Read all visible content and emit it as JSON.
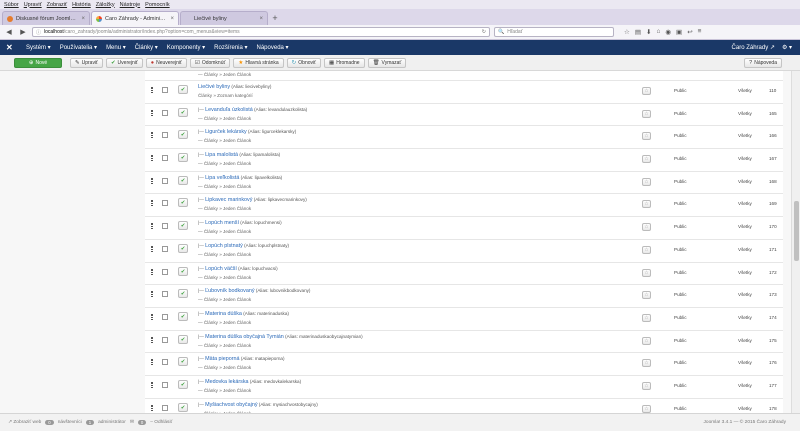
{
  "browser": {
    "menu": [
      "Súbor",
      "Upraviť",
      "Zobraziť",
      "História",
      "Záložky",
      "Nástroje",
      "Pomocník"
    ],
    "tabs": [
      {
        "title": "Diskusné fórum Joomla - Tvorba...",
        "active": false
      },
      {
        "title": "Čaro Záhrady - Administrácia",
        "active": true
      },
      {
        "title": "Liečivé byliny",
        "active": false
      }
    ],
    "new_tab": "+",
    "url_host": "localhost",
    "url_path": "/caro_zahrady/joomla/administrator/index.php?option=com_menus&view=items",
    "search_placeholder": "Hľadať"
  },
  "joomla_nav": {
    "items": [
      "Systém ▾",
      "Používatelia ▾",
      "Menu ▾",
      "Články ▾",
      "Komponenty ▾",
      "Rozšírenia ▾",
      "Nápoveda ▾"
    ],
    "site_name": "Čaro Záhrady ↗",
    "user_icon": "user-icon ▾"
  },
  "toolbar": {
    "new": "Nové",
    "edit": "Upraviť",
    "publish": "Uverejniť",
    "unpublish": "Neuverejniť",
    "checkin": "Odomknúť",
    "home": "Hlavná stránka",
    "rebuild": "Obnoviť",
    "batch": "Hromadne",
    "trash": "Vymazať",
    "help": "Nápoveda"
  },
  "rows": [
    {
      "partial": true,
      "sub": "— Články » Jeden Článok"
    },
    {
      "tree": "",
      "name": "Liečivé byliny",
      "alias": "(Alias: liecivebyliny)",
      "sub": "Články » Zoznam kategórií",
      "access": "Public",
      "lang": "Všetky",
      "id": "110"
    },
    {
      "tree": "|— ",
      "name": "Levanduľa úzkolistá",
      "alias": "(Alias: levandulauzkolista)",
      "sub": "— Články » Jeden Článok",
      "access": "Public",
      "lang": "Všetky",
      "id": "165"
    },
    {
      "tree": "|— ",
      "name": "Ligurček lekársky",
      "alias": "(Alias: ligurceklekarsky)",
      "sub": "— Články » Jeden Článok",
      "access": "Public",
      "lang": "Všetky",
      "id": "166"
    },
    {
      "tree": "|— ",
      "name": "Lipa malolistá",
      "alias": "(Alias: lipamalolista)",
      "sub": "— Články » Jeden Článok",
      "access": "Public",
      "lang": "Všetky",
      "id": "167"
    },
    {
      "tree": "|— ",
      "name": "Lipa veľkolistá",
      "alias": "(Alias: lipavelkolista)",
      "sub": "— Články » Jeden Článok",
      "access": "Public",
      "lang": "Všetky",
      "id": "168"
    },
    {
      "tree": "|— ",
      "name": "Lipkavec marinkový",
      "alias": "(Alias: lipkavecmarinkovy)",
      "sub": "— Články » Jeden Článok",
      "access": "Public",
      "lang": "Všetky",
      "id": "169"
    },
    {
      "tree": "|— ",
      "name": "Lopúch menší",
      "alias": "(Alias: lopuchmensi)",
      "sub": "— Články » Jeden Článok",
      "access": "Public",
      "lang": "Všetky",
      "id": "170"
    },
    {
      "tree": "|— ",
      "name": "Lopúch plstnatý",
      "alias": "(Alias: lopuchplstnaty)",
      "sub": "— Články » Jeden Článok",
      "access": "Public",
      "lang": "Všetky",
      "id": "171"
    },
    {
      "tree": "|— ",
      "name": "Lopúch väčší",
      "alias": "(Alias: lopuchvacsi)",
      "sub": "— Články » Jeden Článok",
      "access": "Public",
      "lang": "Všetky",
      "id": "172"
    },
    {
      "tree": "|— ",
      "name": "Ľubovník bodkovaný",
      "alias": "(Alias: lubovnikbodkovany)",
      "sub": "— Články » Jeden Článok",
      "access": "Public",
      "lang": "Všetky",
      "id": "173"
    },
    {
      "tree": "|— ",
      "name": "Materina dúška",
      "alias": "(Alias: materinaduska)",
      "sub": "— Články » Jeden Článok",
      "access": "Public",
      "lang": "Všetky",
      "id": "174"
    },
    {
      "tree": "|— ",
      "name": "Materina dúška obyčajná Tymián",
      "alias": "(Alias: materinaduskaobycajnatymian)",
      "sub": "— Články » Jeden Článok",
      "access": "Public",
      "lang": "Všetky",
      "id": "175"
    },
    {
      "tree": "|— ",
      "name": "Mäta pieporná",
      "alias": "(Alias: matapieporna)",
      "sub": "— Články » Jeden Článok",
      "access": "Public",
      "lang": "Všetky",
      "id": "176"
    },
    {
      "tree": "|— ",
      "name": "Medovka lekárska",
      "alias": "(Alias: medovkalekarska)",
      "sub": "— Články » Jeden Článok",
      "access": "Public",
      "lang": "Všetky",
      "id": "177"
    },
    {
      "tree": "|— ",
      "name": "Myšiachvost obyčajný",
      "alias": "(Alias: mysiachvostobycajny)",
      "sub": "— Články » Jeden Článok",
      "access": "Public",
      "lang": "Všetky",
      "id": "178"
    }
  ],
  "status": {
    "view_site": "Zobraziť web",
    "visitors_count": "0",
    "visitors_label": "návštevníci",
    "admins_count": "1",
    "admins_label": "administrátor",
    "messages_count": "0",
    "logout": "Odhlásiť",
    "version": "Joomla! 3.4.1 — © 2015 Čaro Záhrady"
  },
  "colors": {
    "joomla_nav": "#1a3867",
    "new_button": "#46a546",
    "link": "#2a69b8"
  }
}
